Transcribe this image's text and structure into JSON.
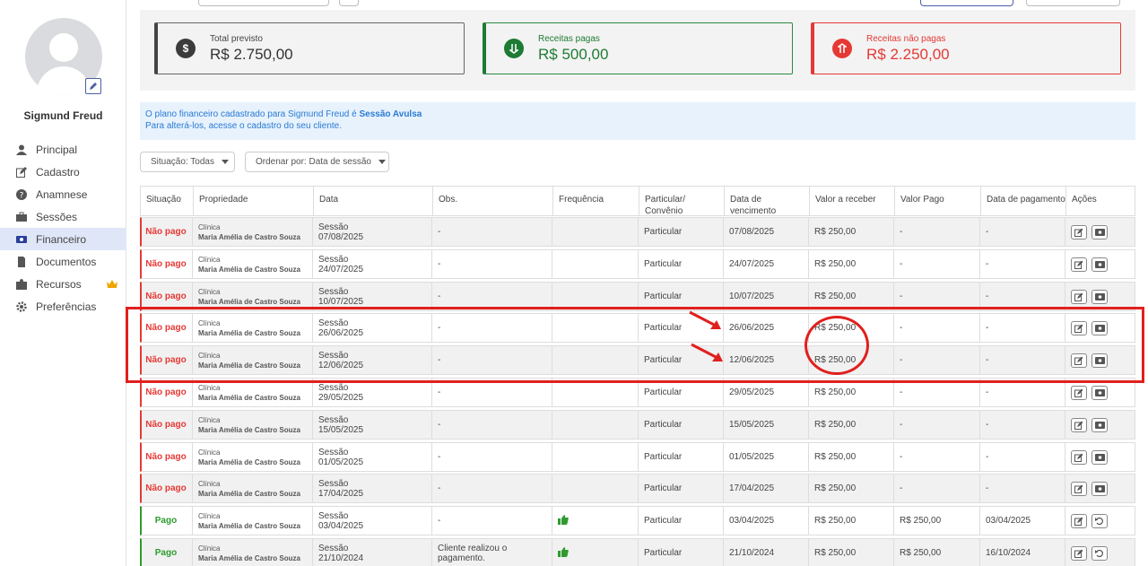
{
  "sidebar": {
    "username": "Sigmund Freud",
    "items": [
      {
        "label": "Principal",
        "icon": "user-icon"
      },
      {
        "label": "Cadastro",
        "icon": "edit-icon"
      },
      {
        "label": "Anamnese",
        "icon": "question-icon"
      },
      {
        "label": "Sessões",
        "icon": "briefcase-icon"
      },
      {
        "label": "Financeiro",
        "icon": "money-icon",
        "active": true
      },
      {
        "label": "Documentos",
        "icon": "document-icon"
      },
      {
        "label": "Recursos",
        "icon": "puzzle-icon"
      },
      {
        "label": "Preferências",
        "icon": "gear-icon"
      }
    ]
  },
  "summary": {
    "total": {
      "label": "Total previsto",
      "value": "R$ 2.750,00",
      "color": "#444444"
    },
    "paid": {
      "label": "Receitas pagas",
      "value": "R$ 500,00",
      "color": "#1e7b34"
    },
    "unpaid": {
      "label": "Receitas não pagas",
      "value": "R$ 2.250,00",
      "color": "#e53935"
    }
  },
  "info": {
    "line1_prefix": "O plano financeiro cadastrado para Sigmund Freud é ",
    "line1_bold": "Sessão Avulsa",
    "line2": "Para alterá-los, acesse o cadastro do seu cliente."
  },
  "filters": {
    "situacao": "Situação: Todas",
    "ordenar": "Ordenar por: Data de sessão"
  },
  "table": {
    "headers": [
      "Situação",
      "Propriedade",
      "Data",
      "Obs.",
      "Frequência",
      "Particular/ Convênio",
      "Data de vencimento",
      "Valor a receber",
      "Valor Pago",
      "Data de pagamento",
      "Ações"
    ],
    "rows": [
      {
        "status": "Não pago",
        "kind": "np",
        "prop1": "Clínica",
        "prop2": "Maria Amélia de Castro Souza",
        "d1": "Sessão",
        "d2": "07/08/2025",
        "obs": "-",
        "freq": "",
        "pc": "Particular",
        "venc": "07/08/2025",
        "valor": "R$ 250,00",
        "pago": "-",
        "dpag": "-"
      },
      {
        "status": "Não pago",
        "kind": "np",
        "prop1": "Clínica",
        "prop2": "Maria Amélia de Castro Souza",
        "d1": "Sessão",
        "d2": "24/07/2025",
        "obs": "-",
        "freq": "",
        "pc": "Particular",
        "venc": "24/07/2025",
        "valor": "R$ 250,00",
        "pago": "-",
        "dpag": "-"
      },
      {
        "status": "Não pago",
        "kind": "np",
        "prop1": "Clínica",
        "prop2": "Maria Amélia de Castro Souza",
        "d1": "Sessão",
        "d2": "10/07/2025",
        "obs": "-",
        "freq": "",
        "pc": "Particular",
        "venc": "10/07/2025",
        "valor": "R$ 250,00",
        "pago": "-",
        "dpag": "-"
      },
      {
        "status": "Não pago",
        "kind": "np",
        "prop1": "Clínica",
        "prop2": "Maria Amélia de Castro Souza",
        "d1": "Sessão",
        "d2": "26/06/2025",
        "obs": "-",
        "freq": "",
        "pc": "Particular",
        "venc": "26/06/2025",
        "valor": "R$ 250,00",
        "pago": "-",
        "dpag": "-"
      },
      {
        "status": "Não pago",
        "kind": "np",
        "prop1": "Clínica",
        "prop2": "Maria Amélia de Castro Souza",
        "d1": "Sessão",
        "d2": "12/06/2025",
        "obs": "-",
        "freq": "",
        "pc": "Particular",
        "venc": "12/06/2025",
        "valor": "R$ 250,00",
        "pago": "-",
        "dpag": "-"
      },
      {
        "status": "Não pago",
        "kind": "np",
        "prop1": "Clínica",
        "prop2": "Maria Amélia de Castro Souza",
        "d1": "Sessão",
        "d2": "29/05/2025",
        "obs": "-",
        "freq": "",
        "pc": "Particular",
        "venc": "29/05/2025",
        "valor": "R$ 250,00",
        "pago": "-",
        "dpag": "-"
      },
      {
        "status": "Não pago",
        "kind": "np",
        "prop1": "Clínica",
        "prop2": "Maria Amélia de Castro Souza",
        "d1": "Sessão",
        "d2": "15/05/2025",
        "obs": "-",
        "freq": "",
        "pc": "Particular",
        "venc": "15/05/2025",
        "valor": "R$ 250,00",
        "pago": "-",
        "dpag": "-"
      },
      {
        "status": "Não pago",
        "kind": "np",
        "prop1": "Clínica",
        "prop2": "Maria Amélia de Castro Souza",
        "d1": "Sessão",
        "d2": "01/05/2025",
        "obs": "-",
        "freq": "",
        "pc": "Particular",
        "venc": "01/05/2025",
        "valor": "R$ 250,00",
        "pago": "-",
        "dpag": "-"
      },
      {
        "status": "Não pago",
        "kind": "np",
        "prop1": "Clínica",
        "prop2": "Maria Amélia de Castro Souza",
        "d1": "Sessão",
        "d2": "17/04/2025",
        "obs": "-",
        "freq": "",
        "pc": "Particular",
        "venc": "17/04/2025",
        "valor": "R$ 250,00",
        "pago": "-",
        "dpag": "-"
      },
      {
        "status": "Pago",
        "kind": "pg",
        "prop1": "Clínica",
        "prop2": "Maria Amélia de Castro Souza",
        "d1": "Sessão",
        "d2": "03/04/2025",
        "obs": "-",
        "freq": "thumbs-up-icon",
        "pc": "Particular",
        "venc": "03/04/2025",
        "valor": "R$ 250,00",
        "pago": "R$ 250,00",
        "dpag": "03/04/2025"
      },
      {
        "status": "Pago",
        "kind": "pg",
        "prop1": "Clínica",
        "prop2": "Maria Amélia de Castro Souza",
        "d1": "Sessão",
        "d2": "21/10/2024",
        "obs": "Cliente realizou o pagamento.",
        "freq": "thumbs-up-icon",
        "pc": "Particular",
        "venc": "21/10/2024",
        "valor": "R$ 250,00",
        "pago": "R$ 250,00",
        "dpag": "16/10/2024"
      }
    ]
  }
}
